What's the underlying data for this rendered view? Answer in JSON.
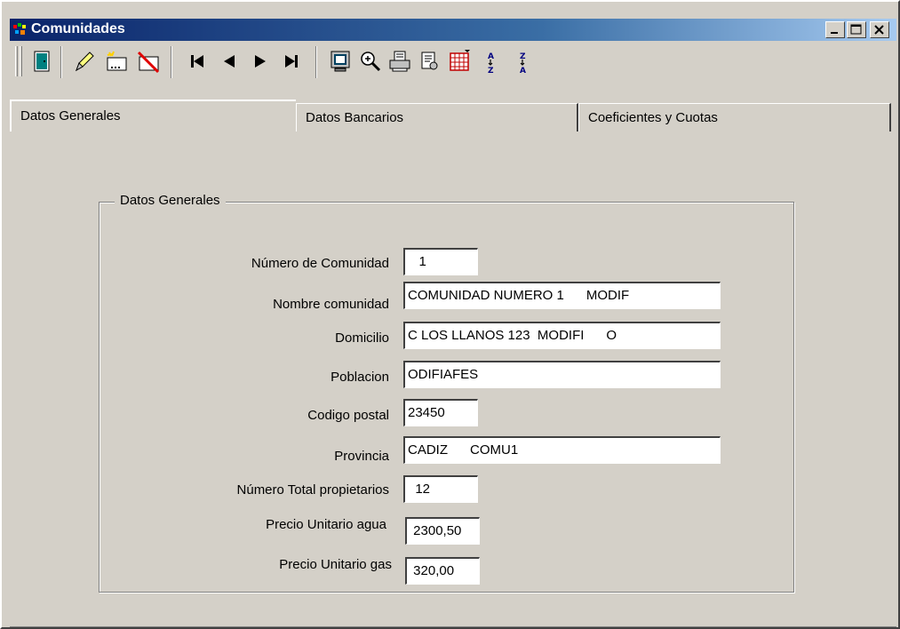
{
  "window": {
    "title": "Comunidades"
  },
  "caption_buttons": [
    "minimize",
    "maximize",
    "close"
  ],
  "toolbar": {
    "buttons": [
      "exit-door",
      "edit-pencil",
      "new-record",
      "delete-record",
      "first-record",
      "previous-record",
      "next-record",
      "last-record",
      "screen-preview",
      "zoom",
      "print",
      "print-preview",
      "grid",
      "sort-ascending",
      "sort-descending"
    ]
  },
  "tabs": [
    {
      "label": "Datos Generales",
      "active": true
    },
    {
      "label": "Datos Bancarios",
      "active": false
    },
    {
      "label": "Coeficientes y Cuotas",
      "active": false
    }
  ],
  "group": {
    "legend": "Datos Generales",
    "fields": {
      "numero_comunidad": {
        "label": "Número de Comunidad",
        "value": "   1"
      },
      "nombre_comunidad": {
        "label": "Nombre comunidad",
        "value": "COMUNIDAD NUMERO 1      MODIF"
      },
      "domicilio": {
        "label": "Domicilio",
        "value": "C LOS LLANOS 123  MODIFI      O"
      },
      "poblacion": {
        "label": "Poblacion",
        "value": "ODIFIAFES"
      },
      "codigo_postal": {
        "label": "Codigo postal",
        "value": "23450"
      },
      "provincia": {
        "label": "Provincia",
        "value": "CADIZ      COMU1"
      },
      "total_propietarios": {
        "label": "Número Total propietarios",
        "value": "  12"
      },
      "precio_agua": {
        "label": "Precio Unitario agua",
        "value": " 2300,50"
      },
      "precio_gas": {
        "label": "Precio Unitario gas",
        "value": " 320,00"
      }
    }
  }
}
